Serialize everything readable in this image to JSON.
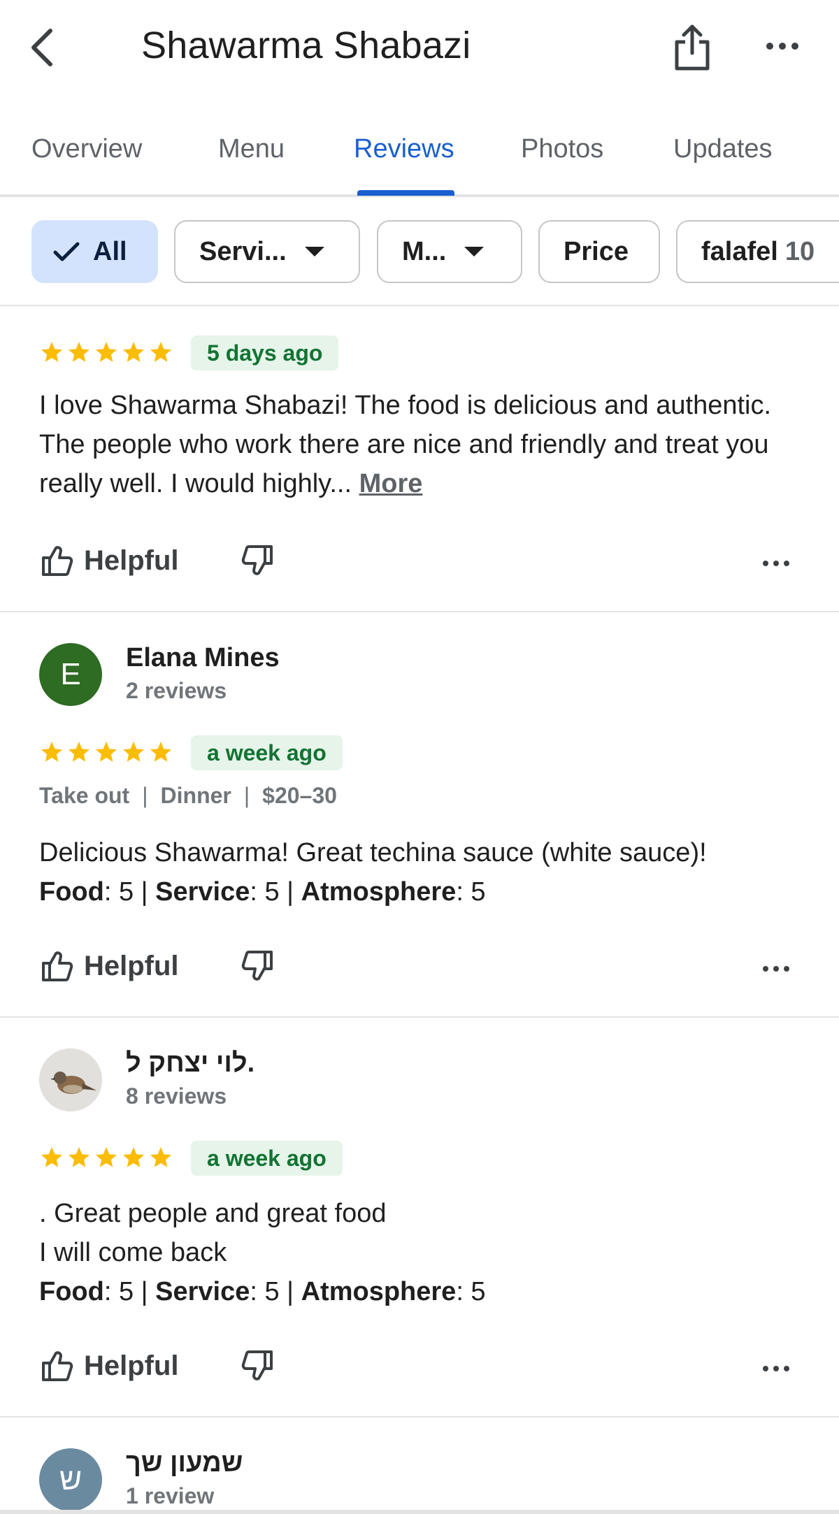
{
  "header": {
    "title": "Shawarma Shabazi",
    "back_icon": "back-arrow-icon",
    "share_icon": "share-icon",
    "more_icon": "more-horizontal-icon"
  },
  "tabs": [
    {
      "label": "Overview",
      "active": false
    },
    {
      "label": "Menu",
      "active": false
    },
    {
      "label": "Reviews",
      "active": true
    },
    {
      "label": "Photos",
      "active": false
    },
    {
      "label": "Updates",
      "active": false
    }
  ],
  "filters": {
    "all": "All",
    "service": "Servi...",
    "meal": "M...",
    "price": "Price",
    "falafel": "falafel",
    "falafel_count": "10"
  },
  "reviews": [
    {
      "date": "5 days ago",
      "rating": 5,
      "text": "I love Shawarma Shabazi! The food is delicious and authentic. The people who work there are nice and friendly and treat you really well. I would highly...",
      "more_label": "More",
      "helpful_label": "Helpful"
    },
    {
      "name": "Elana Mines",
      "avatar_letter": "E",
      "review_count": "2 reviews",
      "rating": 5,
      "date": "a week ago",
      "meta": [
        "Take out",
        "Dinner",
        "$20–30"
      ],
      "text": "Delicious Shawarma! Great techina sauce (white sauce)!",
      "food_label": "Food",
      "food_value": ": 5 | ",
      "service_label": "Service",
      "service_value": ": 5 | ",
      "atmosphere_label": "Atmosphere",
      "atmosphere_value": ": 5",
      "helpful_label": "Helpful"
    },
    {
      "name": "לוי יצחק ל.",
      "review_count": "8 reviews",
      "rating": 5,
      "date": "a week ago",
      "text_line1": ". Great people and great food",
      "text_line2": "I will come back",
      "food_label": "Food",
      "food_value": ": 5 | ",
      "service_label": "Service",
      "service_value": ": 5 | ",
      "atmosphere_label": "Atmosphere",
      "atmosphere_value": ": 5",
      "helpful_label": "Helpful"
    },
    {
      "name": "שמעון שך",
      "avatar_letter": "ש",
      "review_count": "1 review"
    }
  ],
  "colors": {
    "accent": "#1a5fd1",
    "star": "#fbbc04",
    "badge_bg": "#e6f4ea",
    "badge_text": "#137333",
    "avatar_green": "#2e6b23",
    "avatar_slate": "#6a8aa0"
  }
}
